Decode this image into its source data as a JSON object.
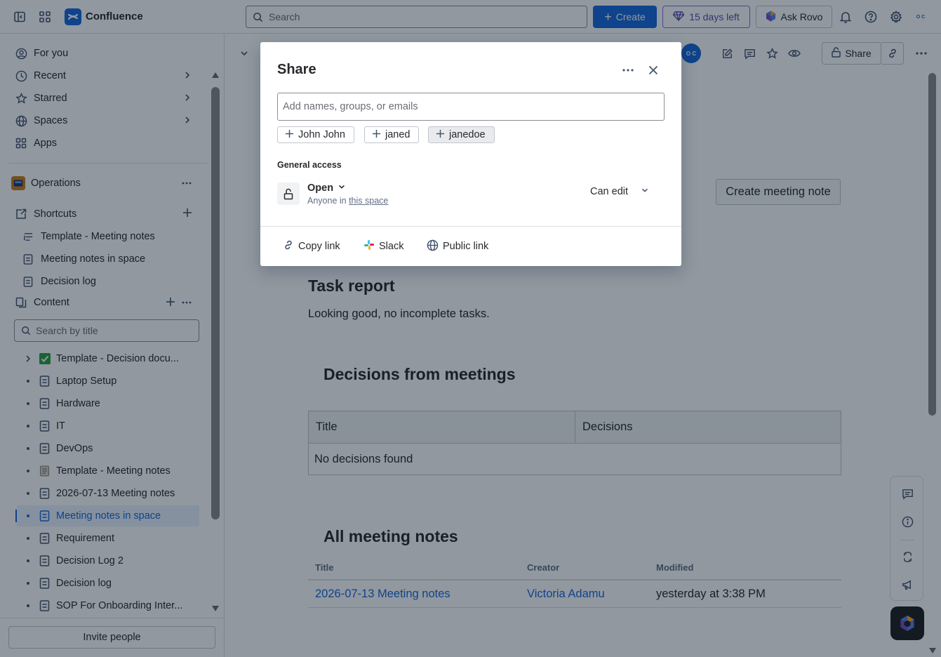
{
  "topbar": {
    "app_name": "Confluence",
    "search_placeholder": "Search",
    "create_label": "Create",
    "trial_label": "15 days left",
    "rovo_label": "Ask Rovo",
    "avatar_initials": "O C"
  },
  "sidebar": {
    "nav": [
      {
        "label": "For you",
        "icon": "person-circle-icon"
      },
      {
        "label": "Recent",
        "icon": "clock-icon"
      },
      {
        "label": "Starred",
        "icon": "star-icon"
      },
      {
        "label": "Spaces",
        "icon": "globe-icon"
      },
      {
        "label": "Apps",
        "icon": "apps-grid-icon"
      }
    ],
    "space_name": "Operations",
    "shortcuts_label": "Shortcuts",
    "shortcuts": [
      "Template - Meeting notes",
      "Meeting notes in space",
      "Decision log"
    ],
    "content_label": "Content",
    "search_placeholder": "Search by title",
    "tree": [
      "Template - Decision docu...",
      "Laptop Setup",
      "Hardware",
      "IT",
      "DevOps",
      "Template - Meeting notes",
      "2026-07-13 Meeting notes",
      "Meeting notes in space",
      "Requirement",
      "Decision Log 2",
      "Decision log",
      "SOP For Onboarding Inter..."
    ],
    "invite_label": "Invite people"
  },
  "toolbar": {
    "owner_initials": "O C",
    "share_label": "Share"
  },
  "page": {
    "create_note_label": "Create meeting note",
    "task_heading": "Task report",
    "task_text": "Looking good, no incomplete tasks.",
    "decisions_heading": "Decisions from meetings",
    "decisions_headers": [
      "Title",
      "Decisions"
    ],
    "decisions_empty": "No decisions found",
    "all_heading": "All meeting notes",
    "all_headers": [
      "Title",
      "Creator",
      "Modified"
    ],
    "all_rows": [
      {
        "title": "2026-07-13 Meeting notes",
        "creator": "Victoria Adamu",
        "modified": "yesterday at 3:38 PM"
      }
    ]
  },
  "share_modal": {
    "title": "Share",
    "input_placeholder": "Add names, groups, or emails",
    "suggestions": [
      "John John",
      "janed",
      "janedoe"
    ],
    "general_access_label": "General access",
    "access_level": "Open",
    "access_sub_prefix": "Anyone in ",
    "access_sub_link": "this space",
    "permission": "Can edit",
    "footer": [
      "Copy link",
      "Slack",
      "Public link"
    ]
  },
  "colors": {
    "brand": "#1868db",
    "trial_purple": "#5e4db2",
    "overlay": "#051524"
  }
}
